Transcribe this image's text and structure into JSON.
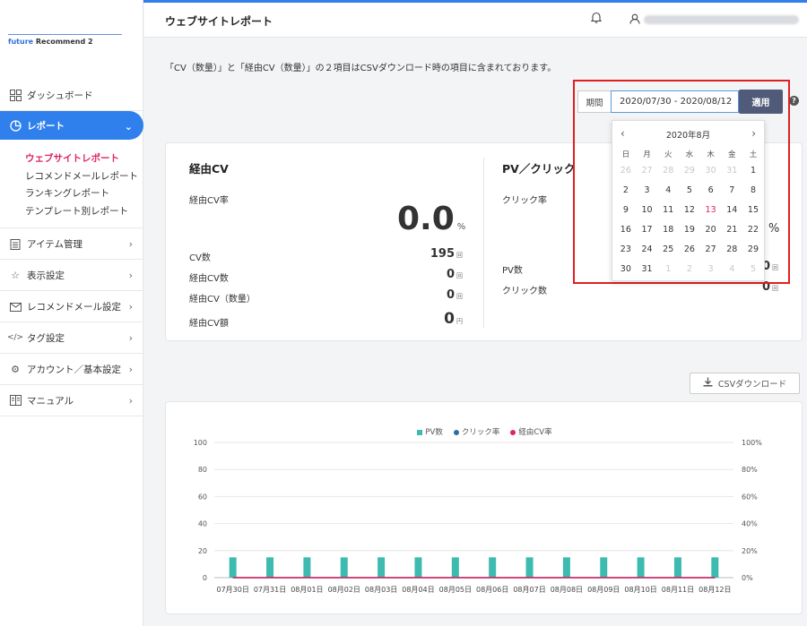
{
  "sidebar": {
    "logo_future": "future",
    "logo_rest": "Recommend 2",
    "items": [
      {
        "label": "ダッシュボード",
        "icon": "dashboard-icon"
      },
      {
        "label": "レポート",
        "icon": "report-icon"
      },
      {
        "label": "アイテム管理",
        "icon": "clipboard-icon"
      },
      {
        "label": "表示設定",
        "icon": "star-icon"
      },
      {
        "label": "レコメンドメール設定",
        "icon": "mail-icon"
      },
      {
        "label": "タグ設定",
        "icon": "code-icon"
      },
      {
        "label": "アカウント／基本設定",
        "icon": "gear-icon"
      },
      {
        "label": "マニュアル",
        "icon": "book-icon"
      }
    ],
    "sub_items": [
      "ウェブサイトレポート",
      "レコメンドメールレポート",
      "ランキングレポート",
      "テンプレート別レポート"
    ]
  },
  "header": {
    "title": "ウェブサイトレポート"
  },
  "notice": "「CV（数量）」と「経由CV（数量）」の２項目はCSVダウンロード時の項目に含まれております。",
  "period": {
    "label": "期間",
    "value": "2020/07/30 - 2020/08/12",
    "apply": "適用",
    "help": "?"
  },
  "calendar": {
    "month": "2020年8月",
    "prev": "‹",
    "next": "›",
    "dow": [
      "日",
      "月",
      "火",
      "水",
      "木",
      "金",
      "土"
    ],
    "days": [
      {
        "d": "26",
        "m": true
      },
      {
        "d": "27",
        "m": true
      },
      {
        "d": "28",
        "m": true
      },
      {
        "d": "29",
        "m": true
      },
      {
        "d": "30",
        "m": true
      },
      {
        "d": "31",
        "m": true
      },
      {
        "d": "1"
      },
      {
        "d": "2"
      },
      {
        "d": "3"
      },
      {
        "d": "4"
      },
      {
        "d": "5"
      },
      {
        "d": "6"
      },
      {
        "d": "7"
      },
      {
        "d": "8"
      },
      {
        "d": "9"
      },
      {
        "d": "10"
      },
      {
        "d": "11"
      },
      {
        "d": "12"
      },
      {
        "d": "13",
        "t": true
      },
      {
        "d": "14"
      },
      {
        "d": "15"
      },
      {
        "d": "16"
      },
      {
        "d": "17"
      },
      {
        "d": "18"
      },
      {
        "d": "19"
      },
      {
        "d": "20"
      },
      {
        "d": "21"
      },
      {
        "d": "22"
      },
      {
        "d": "23"
      },
      {
        "d": "24"
      },
      {
        "d": "25"
      },
      {
        "d": "26"
      },
      {
        "d": "27"
      },
      {
        "d": "28"
      },
      {
        "d": "29"
      },
      {
        "d": "30"
      },
      {
        "d": "31"
      },
      {
        "d": "1",
        "m": true
      },
      {
        "d": "2",
        "m": true
      },
      {
        "d": "3",
        "m": true
      },
      {
        "d": "4",
        "m": true
      },
      {
        "d": "5",
        "m": true
      }
    ]
  },
  "summary": {
    "cv": {
      "title": "経由CV",
      "rate_label": "経由CV率",
      "rate_value": "0.0",
      "rate_unit": "%",
      "rows": [
        {
          "label": "CV数",
          "value": "195",
          "unit": "回"
        },
        {
          "label": "経由CV数",
          "value": "0",
          "unit": "回"
        },
        {
          "label": "経由CV（数量）",
          "value": "0",
          "unit": "回"
        },
        {
          "label": "経由CV額",
          "value": "0",
          "unit": "円"
        }
      ]
    },
    "pv": {
      "title": "PV／クリック",
      "rate_label": "クリック率",
      "rate_unit": "%",
      "rows": [
        {
          "label": "PV数",
          "value": "0",
          "unit": "回"
        },
        {
          "label": "クリック数",
          "value": "0",
          "unit": "回"
        }
      ]
    }
  },
  "csv_button": "CSVダウンロード",
  "chart_data": {
    "type": "bar",
    "categories": [
      "07月30日",
      "07月31日",
      "08月01日",
      "08月02日",
      "08月03日",
      "08月04日",
      "08月05日",
      "08月06日",
      "08月07日",
      "08月08日",
      "08月09日",
      "08月10日",
      "08月11日",
      "08月12日"
    ],
    "series": [
      {
        "name": "PV数",
        "type": "bar",
        "axis": "left",
        "color": "#3dbbb1",
        "values": [
          15,
          15,
          15,
          15,
          15,
          15,
          15,
          15,
          15,
          15,
          15,
          15,
          15,
          15
        ]
      },
      {
        "name": "クリック率",
        "type": "line",
        "axis": "right",
        "color": "#2d6fa3",
        "values": [
          0,
          0,
          0,
          0,
          0,
          0,
          0,
          0,
          0,
          0,
          0,
          0,
          0,
          0
        ]
      },
      {
        "name": "経由CV率",
        "type": "line",
        "axis": "right",
        "color": "#e0245e",
        "values": [
          0,
          0,
          0,
          0,
          0,
          0,
          0,
          0,
          0,
          0,
          0,
          0,
          0,
          0
        ]
      }
    ],
    "y_left": {
      "ticks": [
        "0",
        "20",
        "40",
        "60",
        "80",
        "100"
      ],
      "range": [
        0,
        100
      ]
    },
    "y_right": {
      "ticks": [
        "0%",
        "20%",
        "40%",
        "60%",
        "80%",
        "100%"
      ],
      "range": [
        0,
        100
      ]
    },
    "grid": true,
    "legend": "top"
  }
}
